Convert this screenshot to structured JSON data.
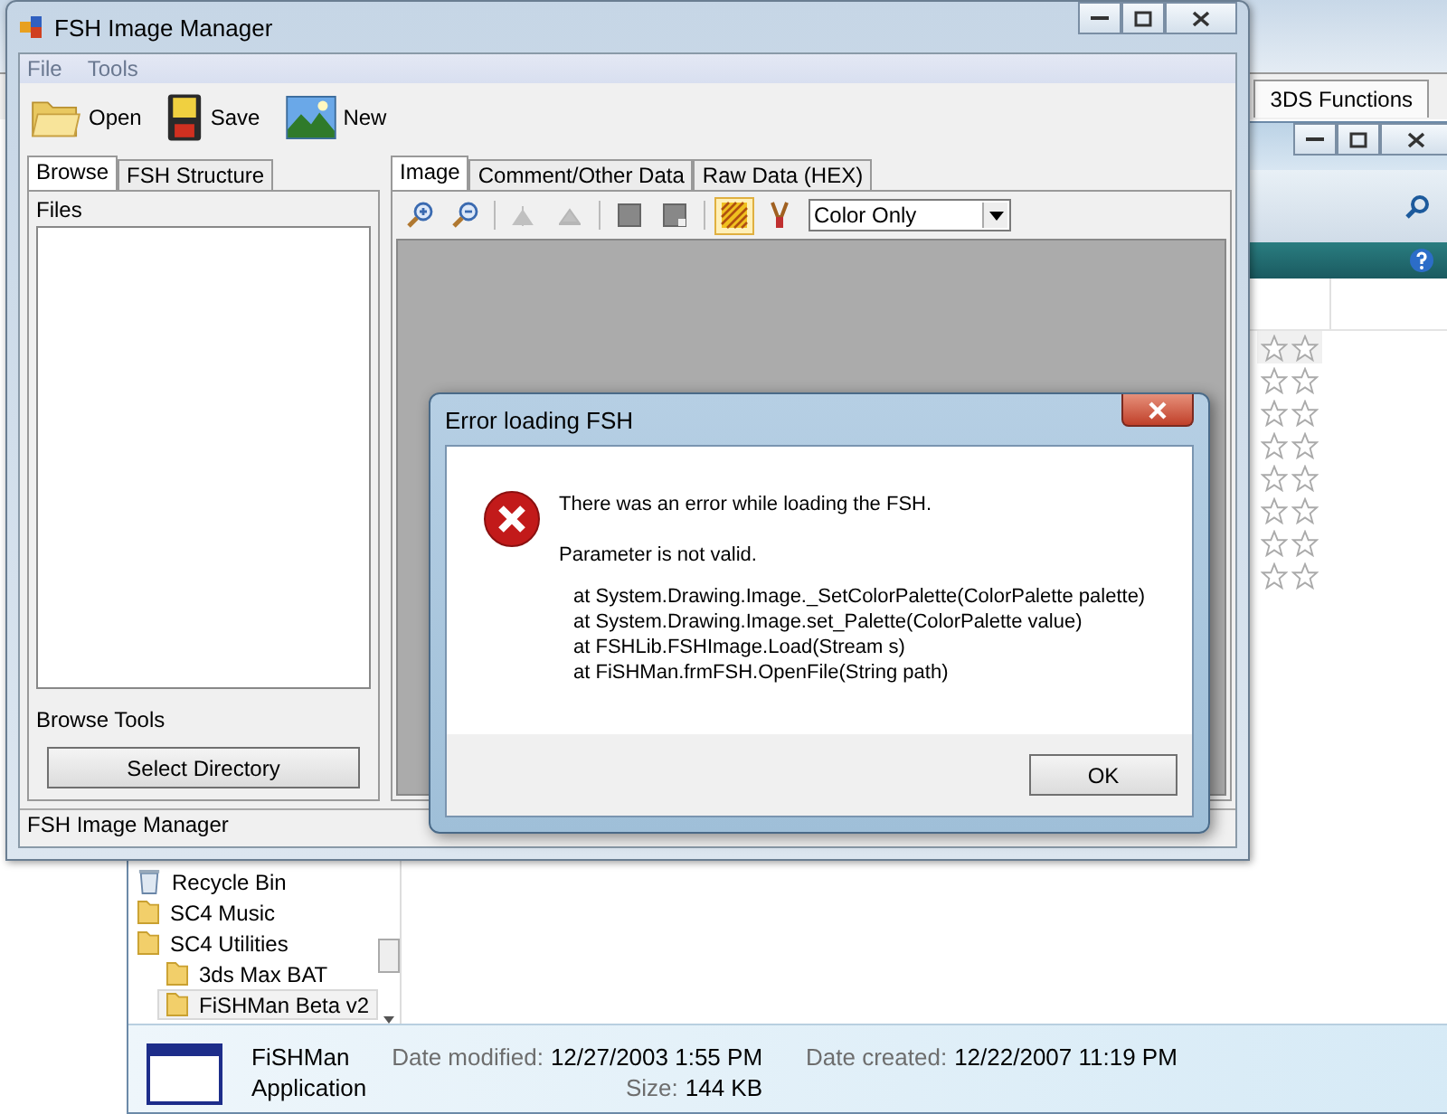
{
  "back_app": {
    "tab": "3DS Functions"
  },
  "explorer": {
    "nav_tree": [
      {
        "label": "Recycle Bin",
        "kind": "bin",
        "selected": false
      },
      {
        "label": "SC4 Music",
        "kind": "folder",
        "selected": false
      },
      {
        "label": "SC4 Utilities",
        "kind": "folder",
        "selected": false,
        "children": [
          {
            "label": "3ds Max BAT",
            "kind": "folder",
            "selected": false
          },
          {
            "label": "FiSHMan Beta v2",
            "kind": "folder",
            "selected": true
          }
        ]
      }
    ],
    "details": {
      "name": "FiSHMan",
      "type": "Application",
      "fields": [
        {
          "label": "Date modified:",
          "value": "12/27/2003 1:55 PM"
        },
        {
          "label": "Size:",
          "value": "144 KB"
        },
        {
          "label": "Date created:",
          "value": "12/22/2007 11:19 PM"
        }
      ]
    }
  },
  "window": {
    "title": "FSH Image Manager",
    "menu": [
      "File",
      "Tools"
    ],
    "toolbar": [
      {
        "label": "Open",
        "kind": "open"
      },
      {
        "label": "Save",
        "kind": "save"
      },
      {
        "label": "New",
        "kind": "new"
      }
    ],
    "left_tabs": [
      {
        "label": "Browse",
        "selected": true
      },
      {
        "label": "FSH Structure",
        "selected": false
      }
    ],
    "files_label": "Files",
    "browse_tools_label": "Browse Tools",
    "select_button": "Select Directory",
    "right_tabs": [
      {
        "label": "Image",
        "selected": true
      },
      {
        "label": "Comment/Other Data",
        "selected": false
      },
      {
        "label": "Raw Data (HEX)",
        "selected": false
      }
    ],
    "image_tools": [
      {
        "kind": "zoom-in",
        "disabled": false,
        "selected": false
      },
      {
        "kind": "zoom-out",
        "disabled": false,
        "selected": false
      },
      {
        "kind": "mirror",
        "disabled": true,
        "selected": false
      },
      {
        "kind": "flip",
        "disabled": true,
        "selected": false
      },
      {
        "kind": "square",
        "disabled": false,
        "selected": false
      },
      {
        "kind": "square-alpha",
        "disabled": false,
        "selected": false
      },
      {
        "kind": "hatch",
        "disabled": false,
        "selected": true
      },
      {
        "kind": "brush",
        "disabled": false,
        "selected": false
      }
    ],
    "view_mode": "Color Only",
    "status": "FSH Image Manager"
  },
  "dialog": {
    "title": "Error loading FSH",
    "message": "There was an error while loading the FSH.",
    "detail": "Parameter is not valid.",
    "stack": [
      "at System.Drawing.Image._SetColorPalette(ColorPalette palette)",
      "at System.Drawing.Image.set_Palette(ColorPalette value)",
      "at FSHLib.FSHImage.Load(Stream s)",
      "at FiSHMan.frmFSH.OpenFile(String path)"
    ],
    "button": "OK"
  }
}
